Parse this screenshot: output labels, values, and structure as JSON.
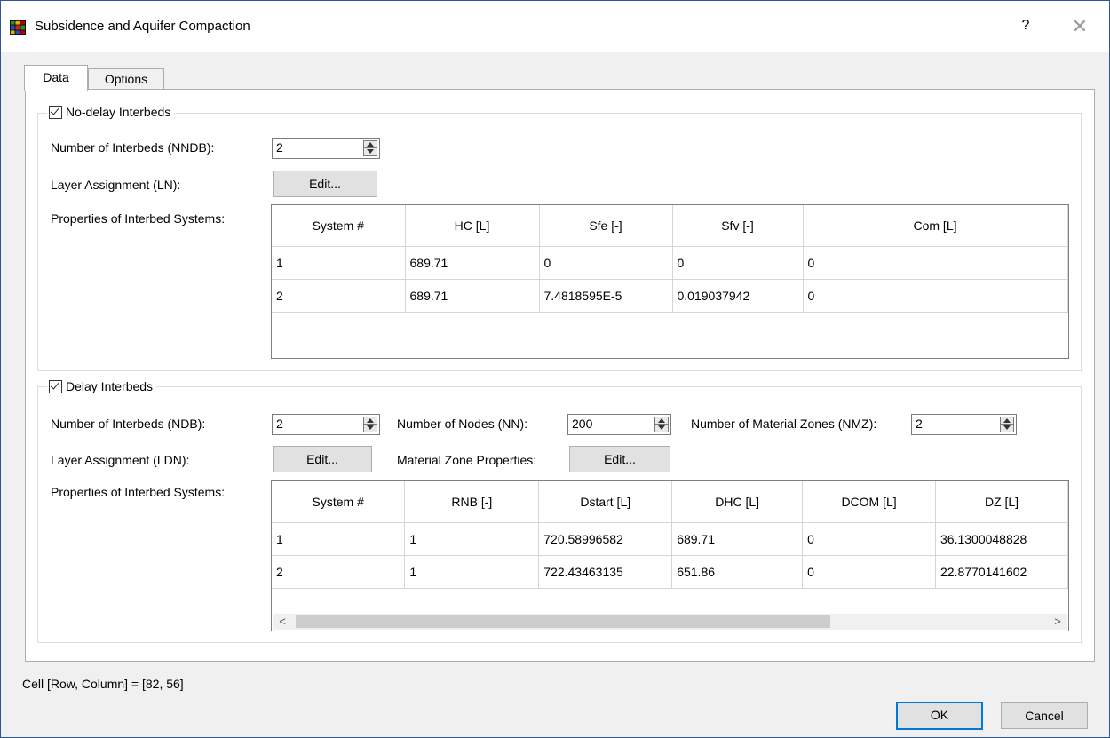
{
  "window": {
    "title": "Subsidence and Aquifer Compaction",
    "help_label": "?",
    "close_label": "✕"
  },
  "tabs": [
    {
      "label": "Data",
      "active": true
    },
    {
      "label": "Options",
      "active": false
    }
  ],
  "no_delay": {
    "group_label": "No-delay Interbeds",
    "checked": true,
    "nndb_label": "Number of Interbeds (NNDB):",
    "nndb_value": "2",
    "ln_label": "Layer Assignment (LN):",
    "ln_button": "Edit...",
    "props_label": "Properties of Interbed Systems:",
    "table": {
      "columns": [
        "System #",
        "HC [L]",
        "Sfe [-]",
        "Sfv [-]",
        "Com [L]"
      ],
      "rows": [
        [
          "1",
          "689.71",
          "0",
          "0",
          "0"
        ],
        [
          "2",
          "689.71",
          "7.4818595E-5",
          "0.019037942",
          "0"
        ]
      ]
    }
  },
  "delay": {
    "group_label": "Delay Interbeds",
    "checked": true,
    "ndb_label": "Number of Interbeds (NDB):",
    "ndb_value": "2",
    "nn_label": "Number of Nodes (NN):",
    "nn_value": "200",
    "nmz_label": "Number of Material Zones (NMZ):",
    "nmz_value": "2",
    "ldn_label": "Layer Assignment (LDN):",
    "ldn_button": "Edit...",
    "mz_label": "Material Zone Properties:",
    "mz_button": "Edit...",
    "props_label": "Properties of Interbed Systems:",
    "table": {
      "columns": [
        "System #",
        "RNB [-]",
        "Dstart [L]",
        "DHC [L]",
        "DCOM [L]",
        "DZ [L]"
      ],
      "rows": [
        [
          "1",
          "1",
          "720.58996582",
          "689.71",
          "0",
          "36.1300048828"
        ],
        [
          "2",
          "1",
          "722.43463135",
          "651.86",
          "0",
          "22.8770141602"
        ]
      ]
    },
    "scroll_left": "<",
    "scroll_right": ">"
  },
  "status_text": "Cell [Row, Column] = [82, 56]",
  "buttons": {
    "ok": "OK",
    "cancel": "Cancel"
  }
}
